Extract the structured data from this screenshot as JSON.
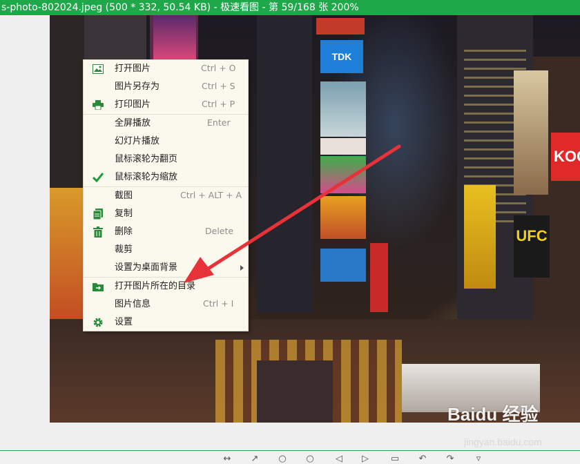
{
  "title_bar": {
    "text": "s-photo-802024.jpeg (500 * 332, 50.54 KB) - 极速看图 - 第 59/168 张 200%"
  },
  "colors": {
    "accent": "#1fa84a",
    "menu_bg": "#fbf9ee",
    "arrow": "#e8323a"
  },
  "photo_signs": {
    "tdk": "TDK",
    "ufc": "UFC",
    "koc": "KOC"
  },
  "context_menu": {
    "items": [
      {
        "label": "打开图片",
        "shortcut": "Ctrl + O",
        "icon": "image-icon"
      },
      {
        "label": "图片另存为",
        "shortcut": "Ctrl + S",
        "icon": ""
      },
      {
        "label": "打印图片",
        "shortcut": "Ctrl + P",
        "icon": "printer-icon"
      },
      {
        "label": "全屏播放",
        "shortcut": "Enter",
        "icon": ""
      },
      {
        "label": "幻灯片播放",
        "shortcut": "",
        "icon": ""
      },
      {
        "label": "鼠标滚轮为翻页",
        "shortcut": "",
        "icon": ""
      },
      {
        "label": "鼠标滚轮为缩放",
        "shortcut": "",
        "icon": "checkmark-icon"
      },
      {
        "label": "截图",
        "shortcut": "Ctrl + ALT + A",
        "icon": ""
      },
      {
        "label": "复制",
        "shortcut": "",
        "icon": "copy-icon"
      },
      {
        "label": "删除",
        "shortcut": "Delete",
        "icon": "trash-icon"
      },
      {
        "label": "裁剪",
        "shortcut": "",
        "icon": ""
      },
      {
        "label": "设置为桌面背景",
        "shortcut": "",
        "icon": ""
      },
      {
        "label": "打开图片所在的目录",
        "shortcut": "",
        "icon": "folder-icon"
      },
      {
        "label": "图片信息",
        "shortcut": "Ctrl + I",
        "icon": ""
      },
      {
        "label": "设置",
        "shortcut": "",
        "icon": "gear-icon"
      }
    ]
  },
  "watermark": {
    "logo": "Baidu 经验",
    "url": "jingyan.baidu.com"
  }
}
